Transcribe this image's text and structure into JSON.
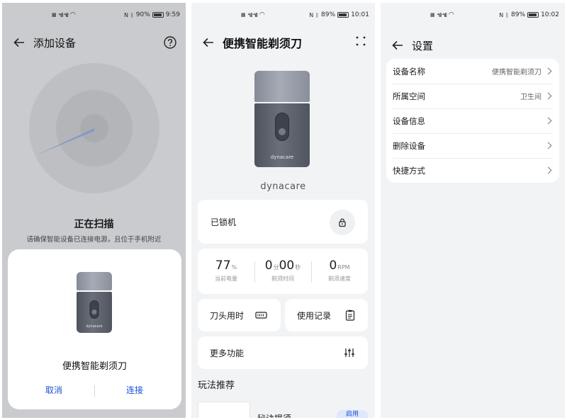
{
  "status": {
    "left_icons": "HD HD",
    "s1": {
      "battery": "90%",
      "time": "9:59",
      "battery_level": 0.9
    },
    "s2": {
      "battery": "89%",
      "time": "10:01",
      "battery_level": 0.89
    },
    "s3": {
      "battery": "89%",
      "time": "10:02",
      "battery_level": 0.89
    }
  },
  "screen1": {
    "title": "添加设备",
    "scanning_title": "正在扫描",
    "scanning_hint": "请确保智能设备已连接电源，且位于手机附近",
    "device_name": "便携智能剃须刀",
    "cancel_label": "取消",
    "connect_label": "连接",
    "device_brand": "dynacare"
  },
  "screen2": {
    "title": "便携智能剃须刀",
    "brand": "dynacare",
    "device_brand": "dynacare",
    "lock_label": "已锁机",
    "stats": [
      {
        "value": "77",
        "unit": "%",
        "caption": "当前电量"
      },
      {
        "value_min": "0",
        "unit_min": "分",
        "value_sec": "00",
        "unit_sec": "秒",
        "caption": "剃须时间"
      },
      {
        "value": "0",
        "unit": "RPM",
        "caption": "剃须速度"
      }
    ],
    "blade_label": "刀头用时",
    "history_label": "使用记录",
    "more_label": "更多功能",
    "recommend_title": "玩法推荐",
    "recommend_item": "秘诀提须",
    "recommend_chip": "启用"
  },
  "screen3": {
    "title": "设置",
    "rows": [
      {
        "label": "设备名称",
        "value": "便携智能剃须刀"
      },
      {
        "label": "所属空间",
        "value": "卫生间"
      },
      {
        "label": "设备信息",
        "value": ""
      },
      {
        "label": "删除设备",
        "value": ""
      },
      {
        "label": "快捷方式",
        "value": ""
      }
    ]
  },
  "icons": {
    "back": "arrow-left-icon",
    "help": "question-circle-icon",
    "more": "more-dots-icon",
    "lock": "lock-icon",
    "blade": "battery-bar-icon",
    "history": "clipboard-icon",
    "more_functions": "sliders-icon"
  },
  "colors": {
    "accent": "#1a4fd6",
    "scan_bg": "#c9cbce",
    "page_bg": "#f1f3f5",
    "card_bg": "#ffffff"
  }
}
